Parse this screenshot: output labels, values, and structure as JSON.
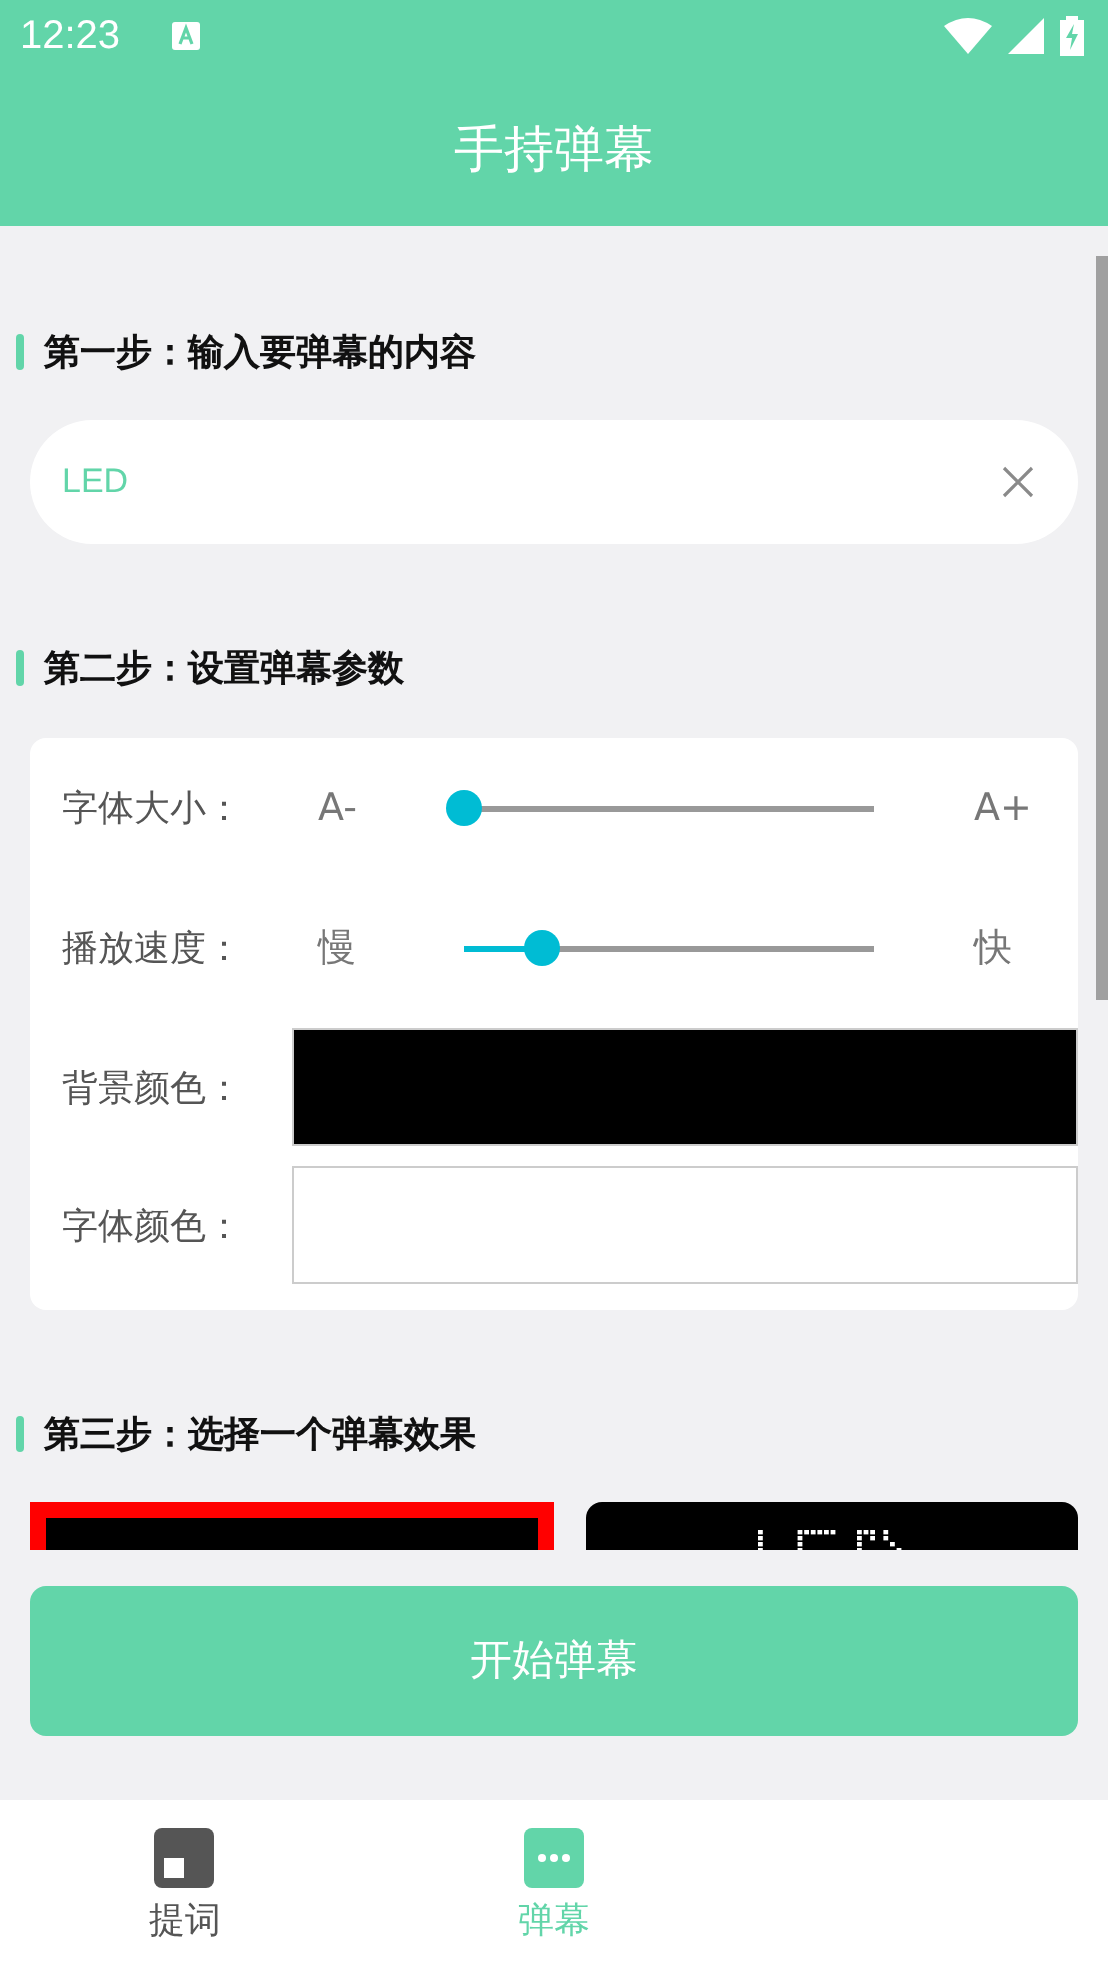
{
  "status_bar": {
    "time": "12:23"
  },
  "header": {
    "title": "手持弹幕"
  },
  "step1": {
    "heading": "第一步：输入要弹幕的内容",
    "input": {
      "value": "LED"
    }
  },
  "step2": {
    "heading": "第二步：设置弹幕参数",
    "sliders": [
      {
        "label": "字体大小：",
        "min_label": "A-",
        "max_label": "A+",
        "level": 0
      },
      {
        "label": "播放速度：",
        "min_label": "慢",
        "max_label": "快",
        "level": 0.19
      }
    ],
    "colors": [
      {
        "label": "背景颜色：",
        "color": "#000000"
      },
      {
        "label": "字体颜色：",
        "color": "#ffffff"
      }
    ]
  },
  "step3": {
    "heading": "第三步：选择一个弹幕效果",
    "effects": [
      {
        "kind": "frame",
        "selected": true
      },
      {
        "kind": "dots",
        "selected": false
      }
    ]
  },
  "start_button": "开始弹幕",
  "nav": [
    {
      "label": "提词",
      "selected": false
    },
    {
      "label": "弹幕",
      "selected": true
    }
  ]
}
